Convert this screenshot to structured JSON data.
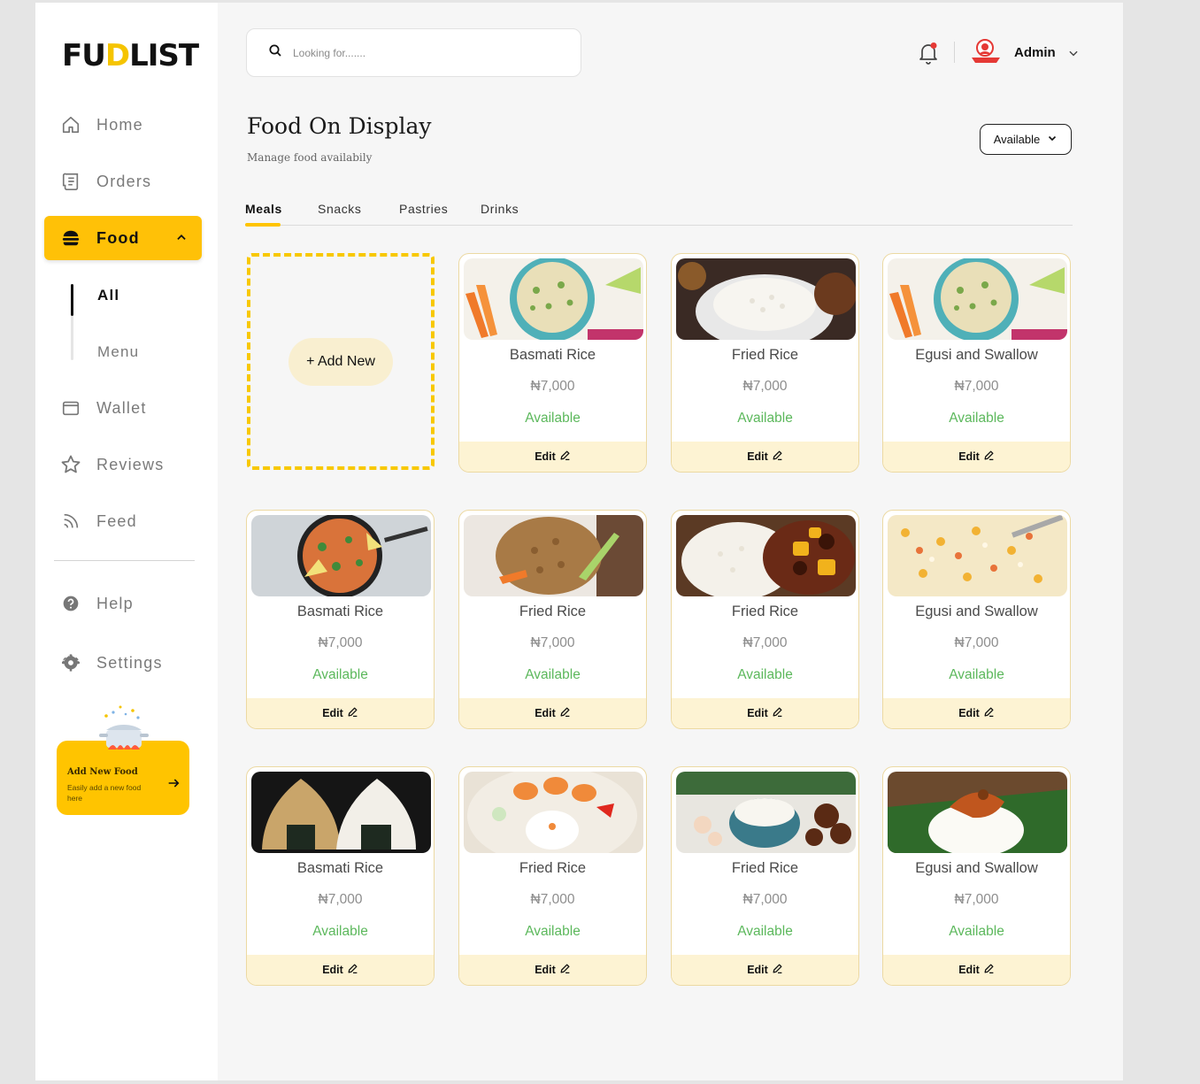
{
  "brand": {
    "logo_pre": "FU",
    "logo_dot": "D",
    "logo_post": "LIST",
    "accent": "#ffc400"
  },
  "sidebar": {
    "home": "Home",
    "orders": "Orders",
    "food": "Food",
    "food_sub": {
      "all": "All",
      "menu": "Menu"
    },
    "wallet": "Wallet",
    "reviews": "Reviews",
    "feed": "Feed",
    "help": "Help",
    "settings": "Settings",
    "promo": {
      "title": "Add New Food",
      "desc": "Easily add a new food here"
    }
  },
  "topbar": {
    "search_placeholder": "Looking for.......",
    "user_name": "Admin"
  },
  "header": {
    "title": "Food On Display",
    "subtitle": "Manage food availabily",
    "filter": "Available"
  },
  "tabs": [
    "Meals",
    "Snacks",
    "Pastries",
    "Drinks"
  ],
  "add_new_label": "+ Add New",
  "items": [
    {
      "name": "Basmati Rice",
      "price": "₦7,000",
      "status": "Available",
      "edit": "Edit",
      "image": "rice-salad-bowl"
    },
    {
      "name": "Fried Rice",
      "price": "₦7,000",
      "status": "Available",
      "edit": "Edit",
      "image": "white-rice-plate"
    },
    {
      "name": "Egusi and Swallow",
      "price": "₦7,000",
      "status": "Available",
      "edit": "Edit",
      "image": "rice-salad-bowl"
    },
    {
      "name": "Basmati Rice",
      "price": "₦7,000",
      "status": "Available",
      "edit": "Edit",
      "image": "paella-pan"
    },
    {
      "name": "Fried Rice",
      "price": "₦7,000",
      "status": "Available",
      "edit": "Edit",
      "image": "jollof-rice"
    },
    {
      "name": "Fried Rice",
      "price": "₦7,000",
      "status": "Available",
      "edit": "Edit",
      "image": "rice-and-stew"
    },
    {
      "name": "Egusi and Swallow",
      "price": "₦7,000",
      "status": "Available",
      "edit": "Edit",
      "image": "fried-rice-closeup"
    },
    {
      "name": "Basmati Rice",
      "price": "₦7,000",
      "status": "Available",
      "edit": "Edit",
      "image": "onigiri"
    },
    {
      "name": "Fried Rice",
      "price": "₦7,000",
      "status": "Available",
      "edit": "Edit",
      "image": "rice-shrimp-plate"
    },
    {
      "name": "Fried Rice",
      "price": "₦7,000",
      "status": "Available",
      "edit": "Edit",
      "image": "rice-bowl-meat"
    },
    {
      "name": "Egusi and Swallow",
      "price": "₦7,000",
      "status": "Available",
      "edit": "Edit",
      "image": "rice-on-leaf"
    }
  ]
}
